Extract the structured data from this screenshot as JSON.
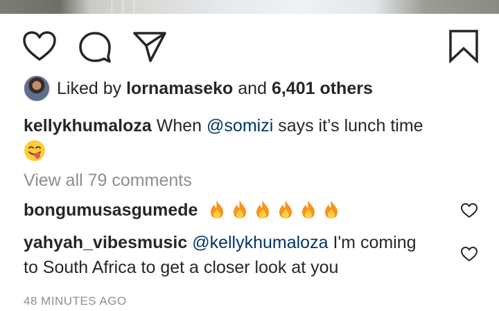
{
  "post": {
    "liked_by_prefix": "Liked by",
    "liked_by_user": "lornamaseko",
    "liked_by_connector": "and",
    "liked_by_others": "6,401 others",
    "caption_user": "kellykhumaloza",
    "caption_text_before": "When",
    "caption_mention": "@somizi",
    "caption_text_after": "says it’s lunch time",
    "caption_emoji": "yum-face-emoji",
    "view_comments": "View all 79 comments",
    "timestamp": "48 MINUTES AGO"
  },
  "comments": [
    {
      "user": "bongumusasgumede",
      "text": "",
      "emoji": "fire-emoji",
      "emoji_count": 6
    },
    {
      "user": "yahyah_vibesmusic",
      "mention": "@kellykhumaloza",
      "text_line1": "I'm coming",
      "text_line2": "to South Africa to get a closer look at you"
    }
  ],
  "icons": {
    "like": "heart-icon",
    "comment": "comment-icon",
    "share": "send-icon",
    "save": "bookmark-icon"
  },
  "colors": {
    "text": "#262626",
    "mention": "#003569",
    "muted": "#8e8e8e"
  }
}
